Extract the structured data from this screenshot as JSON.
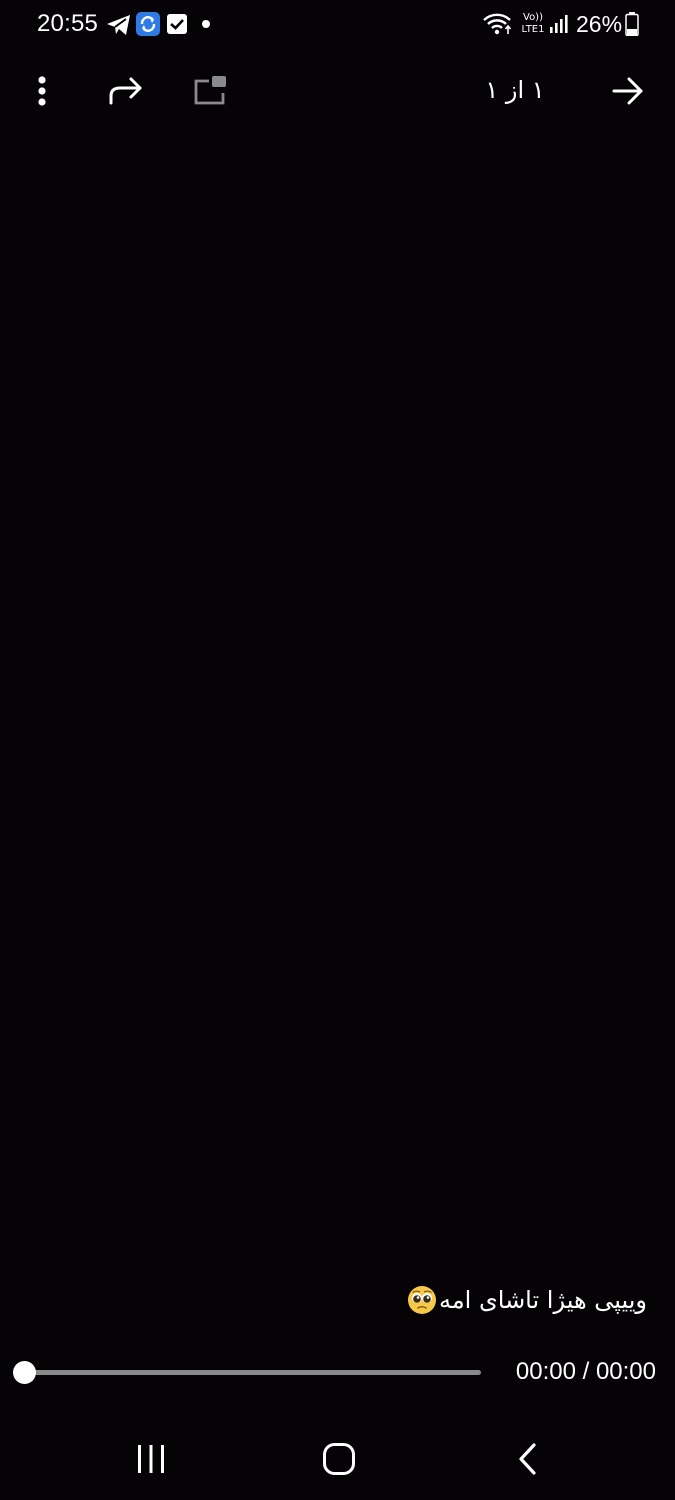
{
  "status_bar": {
    "time": "20:55",
    "battery": "26%",
    "notification_icons": [
      "telegram-icon",
      "sync-app-icon",
      "checkbox-app-icon",
      "more-notifications-dot"
    ],
    "system_icons": [
      "wifi-icon",
      "volte-lte-icon",
      "signal-icon",
      "battery-icon"
    ],
    "volte_label": "Vo))",
    "lte_label": "LTE1"
  },
  "toolbar": {
    "page_counter": "۱ از ۱",
    "icons": [
      "more-options-icon",
      "share-forward-icon",
      "picture-in-picture-icon",
      "back-arrow-icon"
    ]
  },
  "caption": {
    "text": "وییپی هیژا تاشای امه",
    "emoji": "pleading-face-emoji"
  },
  "player": {
    "progress": 0,
    "time": "00:00 / 00:00"
  },
  "nav_bar": {
    "icons": [
      "recent-apps-icon",
      "home-icon",
      "back-icon"
    ]
  },
  "colors": {
    "background": "#050306",
    "foreground": "#ffffff",
    "track": "#8a898c"
  }
}
